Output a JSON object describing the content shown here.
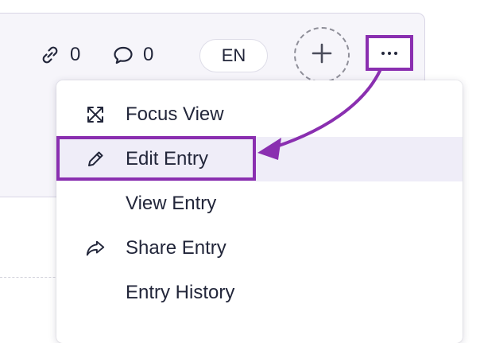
{
  "toolbar": {
    "links_count": "0",
    "comments_count": "0",
    "language": "EN"
  },
  "menu": {
    "items": [
      {
        "label": "Focus View",
        "icon": "expand-arrows-icon"
      },
      {
        "label": "Edit Entry",
        "icon": "pencil-icon",
        "active": true
      },
      {
        "label": "View Entry",
        "icon": ""
      },
      {
        "label": "Share Entry",
        "icon": "share-arrow-icon"
      },
      {
        "label": "Entry History",
        "icon": ""
      }
    ]
  },
  "colors": {
    "annotation": "#8a2fb0",
    "active_row": "#efedf8",
    "card_background": "#f6f5fa",
    "text": "#22263a"
  }
}
